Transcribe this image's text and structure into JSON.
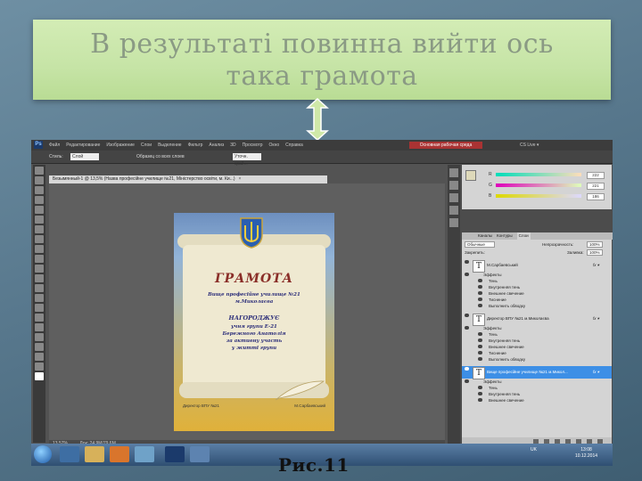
{
  "slide": {
    "title_line1": "В результаті повинна вийти ось",
    "title_line2": "така грамота",
    "caption": "Рис.11"
  },
  "photoshop": {
    "menu": [
      "Файл",
      "Редактирование",
      "Изображение",
      "Слои",
      "Выделение",
      "Фильтр",
      "Анализ",
      "3D",
      "Просмотр",
      "Окно",
      "Справка"
    ],
    "workspace_button": "Основная рабочая среда",
    "cs_live": "CS Live ▾",
    "options": {
      "style_label": "Стиль:",
      "style_value": "Слой",
      "checkbox_label": "Образец со всех слоев",
      "refine": "Уточн. край..."
    },
    "document_tab": "Безымянный-1 @ 13,5% (Назва професійне училище №21, Міністерство освіти, м. Ки...)",
    "status": {
      "zoom": "13,57%",
      "doc_size": "Док: 24,9M/79,6M"
    },
    "certificate": {
      "title": "ГРАМОТА",
      "school_line1": "Вище професійне училище №21",
      "school_line2": "м.Миколаєва",
      "award": "НАГОРОДЖУЄ",
      "student1": "учня групи Е-21",
      "student2": "Бережного Анатолія",
      "student3": "за активну участь",
      "student4": "у житті групи",
      "signature_left": "Директор ВПУ №21",
      "signature_right": "М.Сарбаевський"
    },
    "color_panel": {
      "r_label": "R",
      "r_value": "222",
      "g_label": "G",
      "g_value": "221",
      "b_label": "B",
      "b_value": "186"
    },
    "layers": {
      "tabs": [
        "Каналы",
        "Контуры",
        "Слои"
      ],
      "blend_mode": "Обычные",
      "opacity_label": "Непрозрачность:",
      "opacity_value": "100%",
      "lock_label": "Закрепить:",
      "fill_label": "Заливка:",
      "fill_value": "100%",
      "groups": [
        {
          "name": "М.Сарбаевський",
          "selected": false,
          "effects_label": "Эффекты",
          "effects": [
            "Тень",
            "Внутренняя тень",
            "Внешнее свечение",
            "Тиснение",
            "Выполнить обводку"
          ]
        },
        {
          "name": "Директор ВПУ №21 м.Миколаєва",
          "selected": false,
          "effects_label": "Эффекты",
          "effects": [
            "Тень",
            "Внутренняя тень",
            "Внешнее свечение",
            "Тиснение",
            "Выполнить обводку"
          ]
        },
        {
          "name": "Вище професійне училище №21 м.Микол...",
          "selected": true,
          "effects_label": "Эффекты",
          "effects": [
            "Тень",
            "Внутренняя тень",
            "Внешнее свечение"
          ]
        }
      ]
    }
  },
  "taskbar": {
    "lang": "UK",
    "time": "13:08",
    "date": "10.12.2014"
  },
  "colors": {
    "title_box": "#c6e4a6",
    "title_text": "#8a9a84",
    "arrow_fill": "#cfe8a8",
    "selected_layer": "#3d8fe6",
    "workspace_button": "#aa3333"
  }
}
